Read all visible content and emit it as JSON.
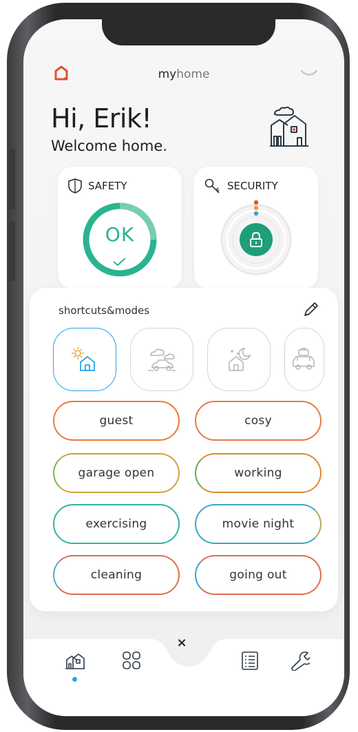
{
  "app": {
    "title_bold": "my",
    "title_light": "home",
    "logo_icon": "home-logo-icon",
    "menu_icon": "chevron-down-icon"
  },
  "header": {
    "greeting": "Hi, Erik!",
    "subtitle": "Welcome home.",
    "illustration_icon": "house-illustration-icon"
  },
  "safety": {
    "label": "SAFETY",
    "status": "OK",
    "icon": "shield-icon",
    "color": "#2bb38f"
  },
  "security": {
    "label": "SECURITY",
    "icon": "key-icon",
    "status_icon": "lock-icon",
    "color": "#1f9e78"
  },
  "shortcuts": {
    "title": "shortcuts&modes",
    "edit_icon": "pencil-icon",
    "tiles": [
      {
        "icon": "sun-house-icon",
        "active": true
      },
      {
        "icon": "cloud-car-icon",
        "active": false
      },
      {
        "icon": "moon-house-icon",
        "active": false
      },
      {
        "icon": "car-luggage-icon",
        "active": false
      }
    ],
    "modes": [
      {
        "label": "guest"
      },
      {
        "label": "cosy"
      },
      {
        "label": "garage open"
      },
      {
        "label": "working"
      },
      {
        "label": "exercising"
      },
      {
        "label": "movie night"
      },
      {
        "label": "cleaning"
      },
      {
        "label": "going out"
      }
    ]
  },
  "nav": {
    "items": [
      {
        "icon": "home-icon",
        "active": true
      },
      {
        "icon": "grid-icon",
        "active": false
      },
      {
        "icon": "close-icon",
        "label": "×"
      },
      {
        "icon": "checklist-icon",
        "active": false
      },
      {
        "icon": "wrench-icon",
        "active": false
      }
    ],
    "accent": "#2ba3e5"
  }
}
